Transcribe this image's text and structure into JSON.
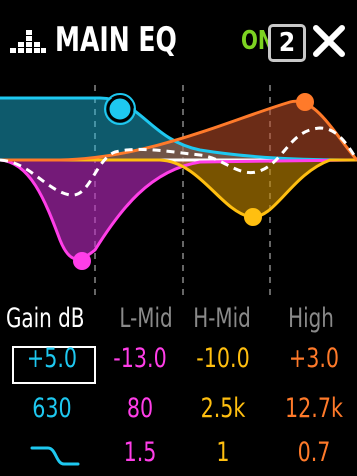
{
  "header": {
    "title": "MAIN EQ",
    "on_label": "ON",
    "preset_number": "2"
  },
  "columns": {
    "gain_label": "Gain dB",
    "lmid_label": "L-Mid",
    "hmid_label": "H-Mid",
    "high_label": "High"
  },
  "rows": {
    "gain": [
      "+5.0",
      "-13.0",
      "-10.0",
      "+3.0"
    ],
    "freq": [
      "630",
      "80",
      "2.5k",
      "12.7k"
    ],
    "q": [
      "1.5",
      "1",
      "0.7"
    ]
  },
  "colors": {
    "low": "#1ec8f0",
    "lmid": "#ff3ee8",
    "hmid": "#ffbf10",
    "high": "#ff7a2a",
    "on": "#7dd321"
  },
  "icons": {
    "eq": "eq-bars-icon",
    "close": "close-icon",
    "low_shelf": "low-shelf-icon"
  }
}
